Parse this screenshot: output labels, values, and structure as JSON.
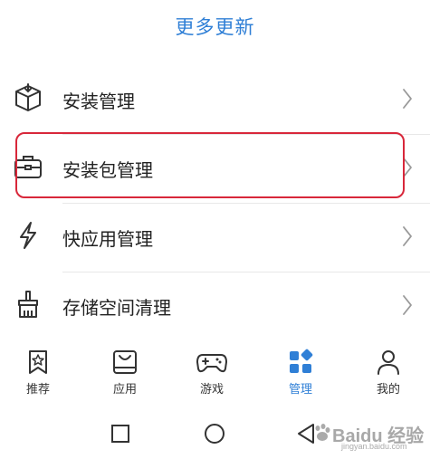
{
  "header": {
    "more_updates": "更多更新"
  },
  "menu": {
    "items": [
      {
        "label": "安装管理",
        "icon": "box-icon"
      },
      {
        "label": "安装包管理",
        "icon": "briefcase-icon"
      },
      {
        "label": "快应用管理",
        "icon": "lightning-icon"
      },
      {
        "label": "存储空间清理",
        "icon": "broom-icon"
      }
    ],
    "highlighted_index": 1,
    "highlight_color": "#d8273a"
  },
  "tabbar": {
    "tabs": [
      {
        "label": "推荐",
        "icon": "bookmark-star-icon"
      },
      {
        "label": "应用",
        "icon": "app-bag-icon"
      },
      {
        "label": "游戏",
        "icon": "gamepad-icon"
      },
      {
        "label": "管理",
        "icon": "manage-grid-icon",
        "active": true
      },
      {
        "label": "我的",
        "icon": "person-icon"
      }
    ],
    "active_color": "#2f7fd6"
  },
  "navbar": {
    "buttons": [
      "recent-apps-square-icon",
      "home-circle-icon",
      "back-triangle-icon"
    ]
  },
  "watermark": {
    "text": "Baidu 经验",
    "sub": "jingyan.baidu.com"
  }
}
